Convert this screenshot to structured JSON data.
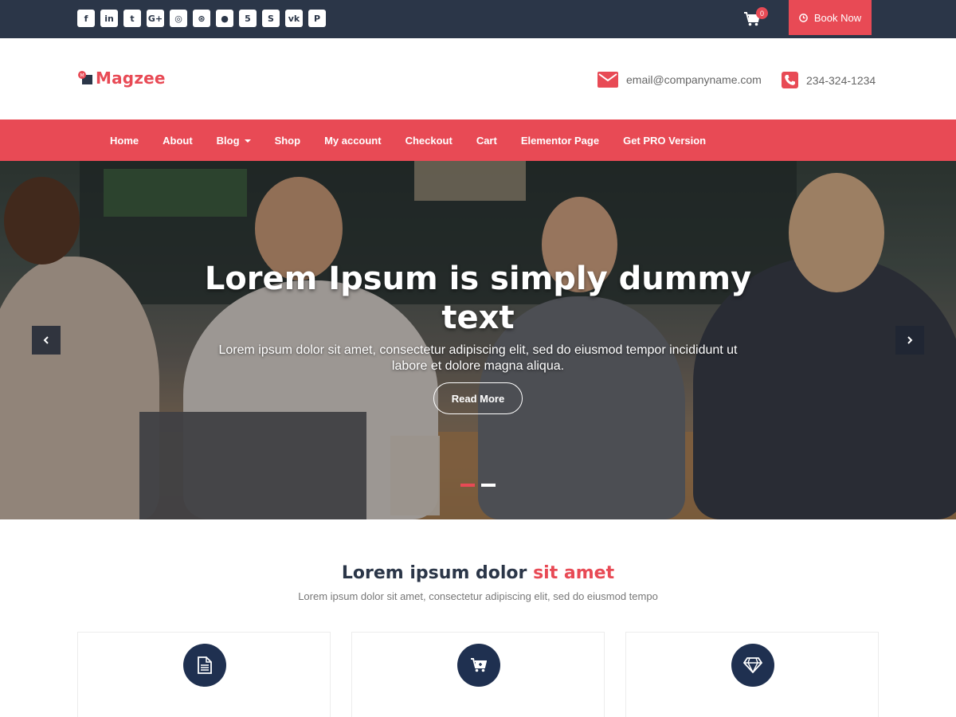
{
  "topbar": {
    "socials": [
      {
        "icon": "facebook-icon",
        "glyph": "f"
      },
      {
        "icon": "linkedin-icon",
        "glyph": "in"
      },
      {
        "icon": "twitter-icon",
        "glyph": "t"
      },
      {
        "icon": "google-plus-icon",
        "glyph": "G+"
      },
      {
        "icon": "instagram-icon",
        "glyph": "◎"
      },
      {
        "icon": "dribbble-icon",
        "glyph": "⊛"
      },
      {
        "icon": "github-icon",
        "glyph": "●"
      },
      {
        "icon": "html5-icon",
        "glyph": "5"
      },
      {
        "icon": "skype-icon",
        "glyph": "S"
      },
      {
        "icon": "vk-icon",
        "glyph": "vk"
      },
      {
        "icon": "pinterest-icon",
        "glyph": "P"
      }
    ],
    "cart_count": "0",
    "book_label": "Book Now"
  },
  "header": {
    "logo_text": "Magzee",
    "email": "email@companyname.com",
    "phone": "234-324-1234"
  },
  "nav": {
    "items": [
      "Home",
      "About",
      "Blog",
      "Shop",
      "My account",
      "Checkout",
      "Cart",
      "Elementor Page",
      "Get PRO Version"
    ]
  },
  "hero": {
    "title": "Lorem Ipsum is simply dummy text",
    "subtitle": "Lorem ipsum dolor sit amet, consectetur adipiscing elit, sed do eiusmod tempor incididunt ut labore et dolore magna aliqua.",
    "button": "Read More",
    "slides": 2,
    "active_slide": 1
  },
  "section": {
    "title_main": "Lorem ipsum dolor",
    "title_accent": "sit amet",
    "subtitle": "Lorem ipsum dolor sit amet, consectetur adipiscing elit, sed do eiusmod tempo",
    "cards": [
      {
        "icon": "document-icon"
      },
      {
        "icon": "cart-add-icon"
      },
      {
        "icon": "diamond-icon"
      }
    ]
  },
  "colors": {
    "accent": "#e84a55",
    "topbar": "#2b3648",
    "icon_circle": "#1f3050"
  }
}
